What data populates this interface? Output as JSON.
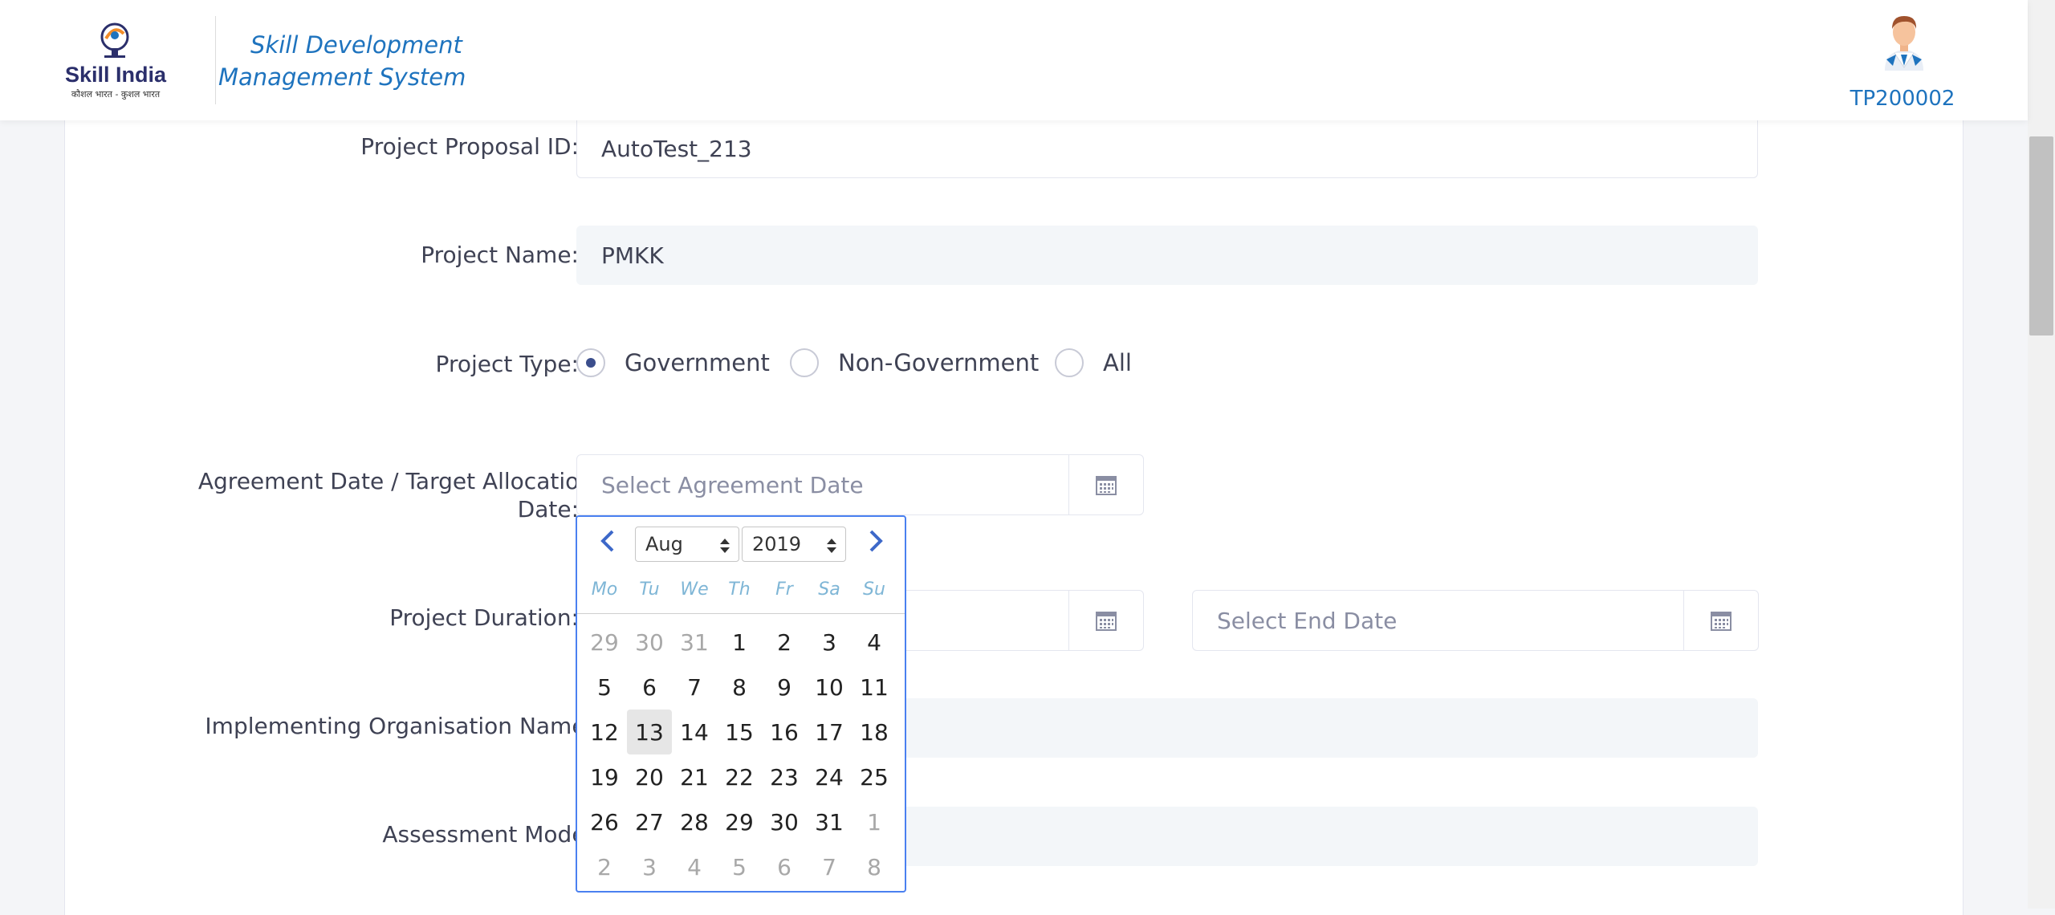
{
  "header": {
    "logo_text": "Skill India",
    "logo_tagline": "कौशल भारत - कुशल भारत",
    "app_title": "Skill Development Management System",
    "user_id": "TP200002"
  },
  "form": {
    "proposal_id": {
      "label": "Project Proposal ID:",
      "value": "AutoTest_213"
    },
    "project_name": {
      "label": "Project Name:",
      "value": "PMKK"
    },
    "project_type": {
      "label": "Project Type:",
      "options": [
        "Government",
        "Non-Government",
        "All"
      ],
      "selected": "Government"
    },
    "agreement_date": {
      "label_line1": "Agreement Date / Target Allocation",
      "label_line2": "Date:",
      "placeholder": "Select Agreement Date"
    },
    "project_duration": {
      "label": "Project Duration:",
      "end_placeholder": "Select End Date"
    },
    "implementing_org": {
      "label": "Implementing Organisation Name:"
    },
    "assessment_mode": {
      "label": "Assessment Mode:"
    },
    "required_marker": "*"
  },
  "datepicker": {
    "month": "Aug",
    "year": "2019",
    "weekdays": [
      "Mo",
      "Tu",
      "We",
      "Th",
      "Fr",
      "Sa",
      "Su"
    ],
    "weeks": [
      [
        "29",
        "30",
        "31",
        "1",
        "2",
        "3",
        "4"
      ],
      [
        "5",
        "6",
        "7",
        "8",
        "9",
        "10",
        "11"
      ],
      [
        "12",
        "13",
        "14",
        "15",
        "16",
        "17",
        "18"
      ],
      [
        "19",
        "20",
        "21",
        "22",
        "23",
        "24",
        "25"
      ],
      [
        "26",
        "27",
        "28",
        "29",
        "30",
        "31",
        "1"
      ],
      [
        "2",
        "3",
        "4",
        "5",
        "6",
        "7",
        "8"
      ]
    ],
    "highlighted_day": "13"
  },
  "colors": {
    "accent_blue": "#1e73be",
    "required_red": "#f1243a",
    "picker_border": "#4a80f0"
  }
}
